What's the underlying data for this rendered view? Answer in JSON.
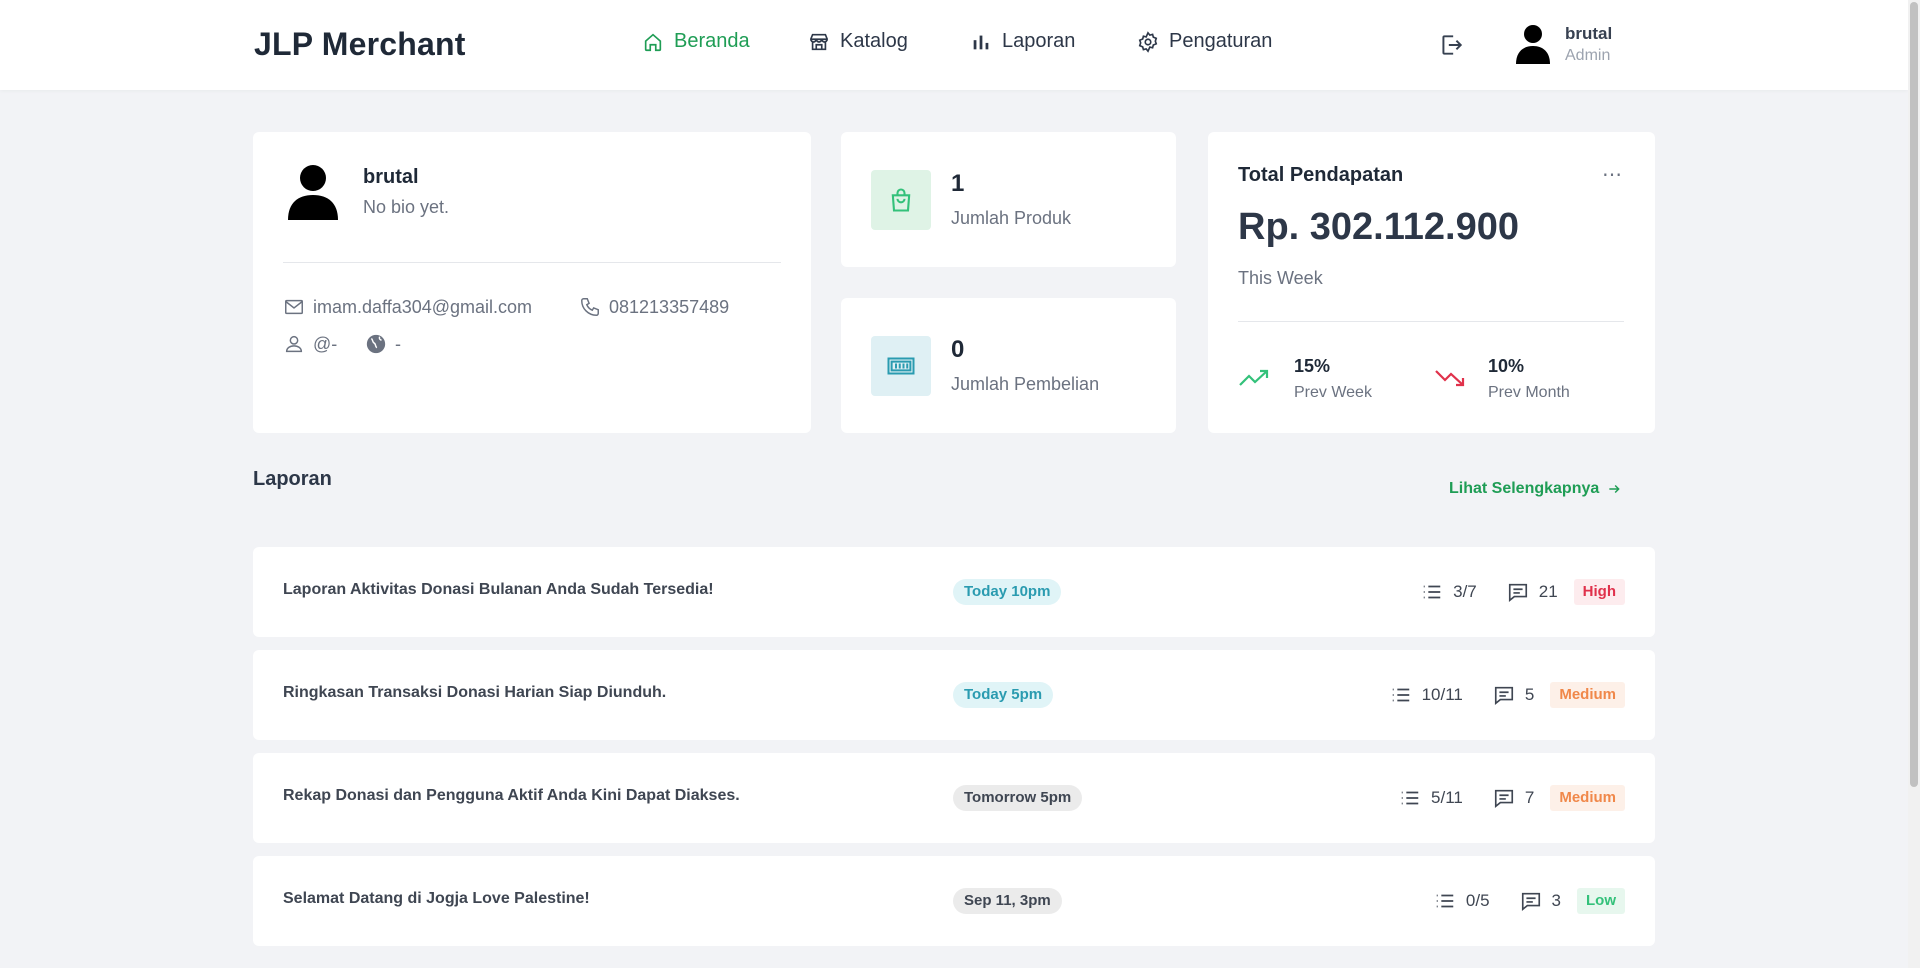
{
  "header": {
    "brand": "JLP Merchant",
    "nav": [
      {
        "label": "Beranda",
        "icon": "home-icon",
        "active": true
      },
      {
        "label": "Katalog",
        "icon": "store-icon",
        "active": false
      },
      {
        "label": "Laporan",
        "icon": "bar-chart-icon",
        "active": false
      },
      {
        "label": "Pengaturan",
        "icon": "gear-icon",
        "active": false
      }
    ],
    "user": {
      "name": "brutal",
      "role": "Admin"
    }
  },
  "profile": {
    "name": "brutal",
    "bio": "No bio yet.",
    "email": "imam.daffa304@gmail.com",
    "phone": "081213357489",
    "username": "@-",
    "website": "-"
  },
  "stats": [
    {
      "value": "1",
      "label": "Jumlah Produk",
      "icon": "shopping-bag-icon"
    },
    {
      "value": "0",
      "label": "Jumlah Pembelian",
      "icon": "money-icon"
    }
  ],
  "revenue": {
    "title": "Total Pendapatan",
    "amount": "Rp. 302.112.900",
    "period": "This Week",
    "trends": [
      {
        "value": "15%",
        "label": "Prev Week",
        "direction": "up"
      },
      {
        "value": "10%",
        "label": "Prev Month",
        "direction": "down"
      }
    ]
  },
  "reports": {
    "title": "Laporan",
    "see_more": "Lihat Selengkapnya",
    "items": [
      {
        "title": "Laporan Aktivitas Donasi Bulanan Anda Sudah Tersedia!",
        "time": "Today 10pm",
        "time_kind": "today",
        "tasks": "3/7",
        "comments": "21",
        "priority": "High"
      },
      {
        "title": "Ringkasan Transaksi Donasi Harian Siap Diunduh.",
        "time": "Today 5pm",
        "time_kind": "today",
        "tasks": "10/11",
        "comments": "5",
        "priority": "Medium"
      },
      {
        "title": "Rekap Donasi dan Pengguna Aktif Anda Kini Dapat Diakses.",
        "time": "Tomorrow 5pm",
        "time_kind": "future",
        "tasks": "5/11",
        "comments": "7",
        "priority": "Medium"
      },
      {
        "title": "Selamat Datang di Jogja Love Palestine!",
        "time": "Sep 11, 3pm",
        "time_kind": "future",
        "tasks": "0/5",
        "comments": "3",
        "priority": "Low"
      }
    ]
  },
  "colors": {
    "accent": "#1f9d55",
    "high": "#e0314b",
    "medium": "#f0884a",
    "low": "#33c17a",
    "today": "#2a9bb0"
  }
}
